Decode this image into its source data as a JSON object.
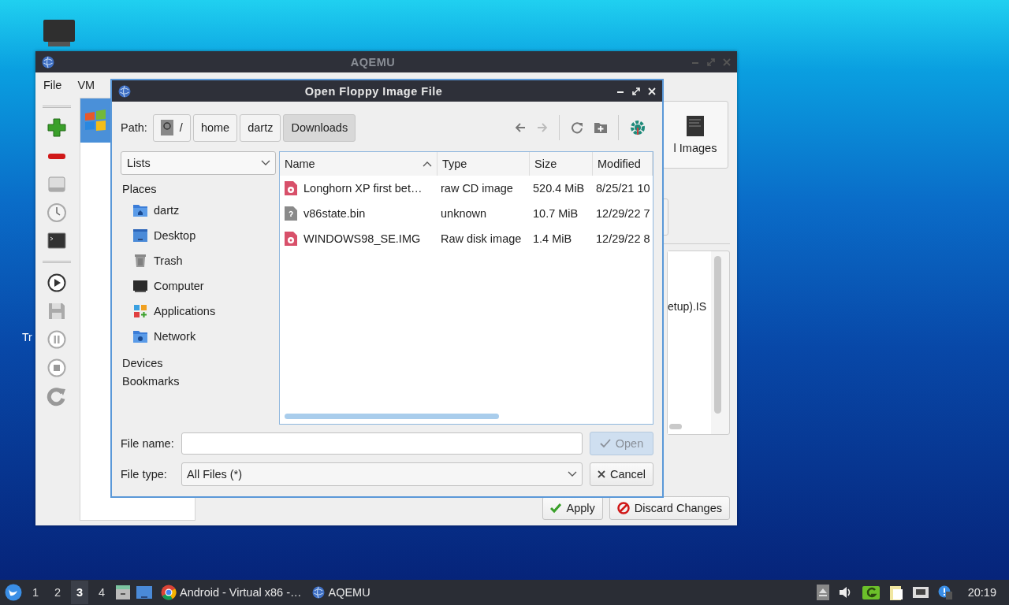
{
  "desktop": {
    "icon_label": "Tr"
  },
  "main_window": {
    "title": "AQEMU",
    "menu": [
      "File",
      "VM"
    ],
    "vm_list": [
      {
        "selected": true
      }
    ],
    "tab_label": "l Images",
    "text_fragment": "etup).IS",
    "buttons": [
      {
        "label": "Apply",
        "kind": "apply"
      },
      {
        "label": "Discard Changes",
        "kind": "discard"
      }
    ]
  },
  "dialog": {
    "title": "Open Floppy Image File",
    "path_label": "Path:",
    "path": [
      {
        "label": "/",
        "kind": "root",
        "selected": false
      },
      {
        "label": "home",
        "kind": "dir",
        "selected": false
      },
      {
        "label": "dartz",
        "kind": "dir",
        "selected": false
      },
      {
        "label": "Downloads",
        "kind": "dir",
        "selected": true
      }
    ],
    "nav": [
      {
        "kind": "back",
        "disabled": false
      },
      {
        "kind": "forward",
        "disabled": true
      },
      {
        "kind": "reload",
        "disabled": false
      },
      {
        "kind": "new-folder",
        "disabled": false
      },
      {
        "kind": "app",
        "disabled": false
      }
    ],
    "sidebar_dropdown": "Lists",
    "sidebar": [
      {
        "title": "Places",
        "children": [
          {
            "label": "dartz",
            "kind": "home"
          },
          {
            "label": "Desktop",
            "kind": "desktop"
          },
          {
            "label": "Trash",
            "kind": "trash"
          },
          {
            "label": "Computer",
            "kind": "computer"
          },
          {
            "label": "Applications",
            "kind": "apps"
          },
          {
            "label": "Network",
            "kind": "network"
          }
        ]
      },
      {
        "title": "Devices"
      },
      {
        "title": "Bookmarks"
      }
    ],
    "table": {
      "columns": [
        {
          "label": "Name",
          "sorted": true
        },
        {
          "label": "Type",
          "sorted": false
        },
        {
          "label": "Size",
          "sorted": false
        },
        {
          "label": "Modified",
          "sorted": false
        }
      ],
      "rows": [
        {
          "kind": "disc",
          "cells": [
            "Longhorn XP first bet…",
            "raw CD image",
            "520.4 MiB",
            "8/25/21 10"
          ]
        },
        {
          "kind": "unknown",
          "cells": [
            "v86state.bin",
            "unknown",
            "10.7 MiB",
            "12/29/22 7"
          ]
        },
        {
          "kind": "disc",
          "cells": [
            "WINDOWS98_SE.IMG",
            "Raw disk image",
            "1.4 MiB",
            "12/29/22 8"
          ]
        }
      ]
    },
    "file_name": {
      "label": "File name:"
    },
    "file_type": {
      "label": "File type:",
      "value": "All Files (*)"
    },
    "buttons": [
      {
        "label": "Open",
        "kind": "open",
        "disabled": true
      },
      {
        "label": "Cancel",
        "kind": "cancel",
        "disabled": false
      }
    ]
  },
  "taskbar": {
    "workspaces": [
      {
        "label": "1",
        "selected": false
      },
      {
        "label": "2",
        "selected": false
      },
      {
        "label": "3",
        "selected": true
      },
      {
        "label": "4",
        "selected": false
      }
    ],
    "tasks": [
      {
        "label": "Android - Virtual x86 -…",
        "kind": "browser"
      },
      {
        "label": "AQEMU",
        "kind": "qemu"
      }
    ],
    "clock": "20:19"
  }
}
